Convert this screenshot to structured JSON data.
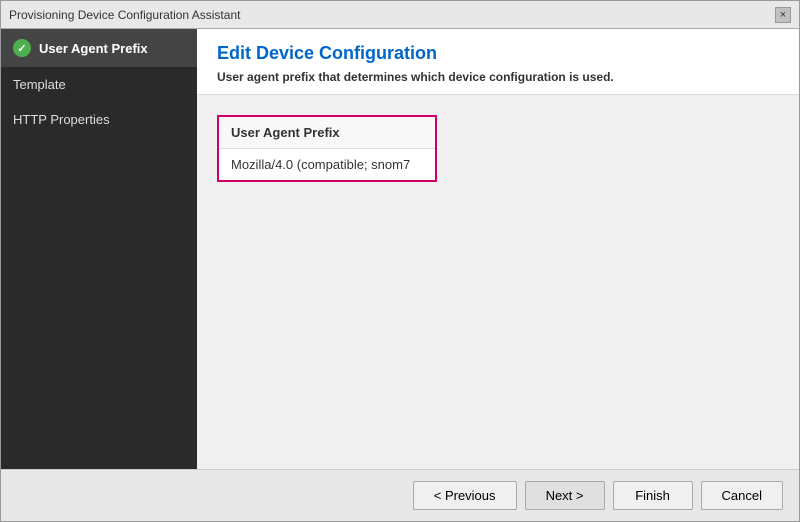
{
  "window": {
    "title": "Provisioning Device Configuration Assistant",
    "close_label": "×"
  },
  "header": {
    "title": "Edit Device Configuration",
    "subtitle": "User agent prefix that determines which device configuration is used."
  },
  "sidebar": {
    "items": [
      {
        "label": "User Agent Prefix",
        "active": true,
        "checked": true
      },
      {
        "label": "Template",
        "active": false,
        "checked": false
      },
      {
        "label": "HTTP Properties",
        "active": false,
        "checked": false
      }
    ]
  },
  "form": {
    "card_header": "User Agent Prefix",
    "card_value": "Mozilla/4.0 (compatible; snom7"
  },
  "footer": {
    "previous_label": "< Previous",
    "next_label": "Next >",
    "finish_label": "Finish",
    "cancel_label": "Cancel"
  }
}
